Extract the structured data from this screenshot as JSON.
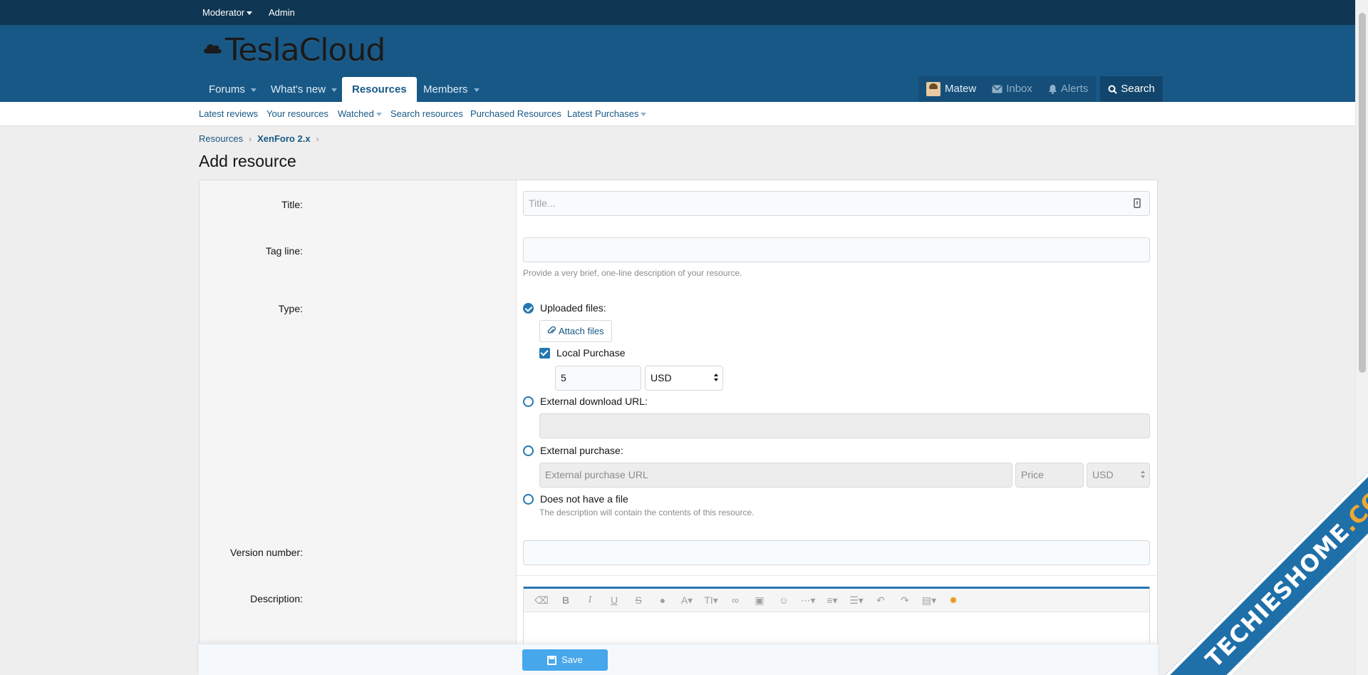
{
  "staffbar": {
    "moderator": "Moderator",
    "admin": "Admin"
  },
  "logo": {
    "text": "TeslaCloud"
  },
  "nav": {
    "tabs": [
      {
        "label": "Forums"
      },
      {
        "label": "What's new"
      },
      {
        "label": "Resources"
      },
      {
        "label": "Members"
      }
    ],
    "user": {
      "name": "Matew",
      "inbox": "Inbox",
      "alerts": "Alerts",
      "search": "Search"
    }
  },
  "subnav": {
    "items": [
      "Latest reviews",
      "Your resources",
      "Watched",
      "Search resources",
      "Purchased Resources",
      "Latest Purchases"
    ]
  },
  "breadcrumb": {
    "root": "Resources",
    "current": "XenForo 2.x"
  },
  "page": {
    "title": "Add resource"
  },
  "form": {
    "title_label": "Title:",
    "title_placeholder": "Title...",
    "tagline_label": "Tag line:",
    "tagline_hint": "Provide a very brief, one-line description of your resource.",
    "type_label": "Type:",
    "type_uploaded": "Uploaded files:",
    "attach_files": "Attach files",
    "local_purchase": "Local Purchase",
    "price_value": "5",
    "currency": "USD",
    "type_external_url": "External download URL:",
    "type_external_purchase": "External purchase:",
    "external_purchase_url_placeholder": "External purchase URL",
    "price_placeholder": "Price",
    "external_currency": "USD",
    "type_no_file": "Does not have a file",
    "no_file_hint": "The description will contain the contents of this resource.",
    "version_label": "Version number:",
    "description_label": "Description:",
    "save": "Save"
  },
  "watermark": {
    "text_white": "TECHIESHOME",
    "text_orange": ".COM"
  },
  "colors": {
    "header": "#185886",
    "staffbar": "#0f3652",
    "accent": "#2577b1",
    "save_button": "#47a7eb"
  }
}
